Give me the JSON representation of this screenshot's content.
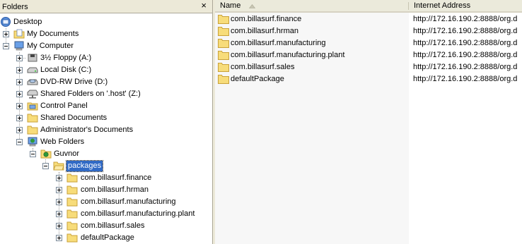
{
  "folders_pane": {
    "title": "Folders",
    "close_glyph": "×",
    "tree": [
      {
        "label": "Desktop",
        "icon": "desktop-icon"
      },
      {
        "label": "My Documents",
        "icon": "my-documents-icon"
      },
      {
        "label": "My Computer",
        "icon": "my-computer-icon"
      },
      {
        "label": "3½ Floppy (A:)",
        "icon": "floppy-drive-icon"
      },
      {
        "label": "Local Disk (C:)",
        "icon": "hard-disk-icon"
      },
      {
        "label": "DVD-RW Drive (D:)",
        "icon": "dvd-drive-icon"
      },
      {
        "label": "Shared Folders on '.host' (Z:)",
        "icon": "network-drive-icon"
      },
      {
        "label": "Control Panel",
        "icon": "control-panel-icon"
      },
      {
        "label": "Shared Documents",
        "icon": "folder-icon"
      },
      {
        "label": "Administrator's Documents",
        "icon": "folder-icon"
      },
      {
        "label": "Web Folders",
        "icon": "web-folders-icon"
      },
      {
        "label": "Guvnor",
        "icon": "web-folder-icon"
      },
      {
        "label": "packages",
        "icon": "open-folder-icon",
        "selected": true
      },
      {
        "label": "com.billasurf.finance",
        "icon": "folder-icon"
      },
      {
        "label": "com.billasurf.hrman",
        "icon": "folder-icon"
      },
      {
        "label": "com.billasurf.manufacturing",
        "icon": "folder-icon"
      },
      {
        "label": "com.billasurf.manufacturing.plant",
        "icon": "folder-icon"
      },
      {
        "label": "com.billasurf.sales",
        "icon": "folder-icon"
      },
      {
        "label": "defaultPackage",
        "icon": "folder-icon"
      }
    ]
  },
  "list_pane": {
    "columns": [
      {
        "label": "Name",
        "sorted": "ascending"
      },
      {
        "label": "Internet Address"
      }
    ],
    "rows": [
      {
        "name": "com.billasurf.finance",
        "address": "http://172.16.190.2:8888/org.d"
      },
      {
        "name": "com.billasurf.hrman",
        "address": "http://172.16.190.2:8888/org.d"
      },
      {
        "name": "com.billasurf.manufacturing",
        "address": "http://172.16.190.2:8888/org.d"
      },
      {
        "name": "com.billasurf.manufacturing.plant",
        "address": "http://172.16.190.2:8888/org.d"
      },
      {
        "name": "com.billasurf.sales",
        "address": "http://172.16.190.2:8888/org.d"
      },
      {
        "name": "defaultPackage",
        "address": "http://172.16.190.2:8888/org.d"
      }
    ]
  },
  "colors": {
    "selection": "#316ac5",
    "folder_fill": "#f7dc7a",
    "folder_stroke": "#c9a23a",
    "header_bg": "#ece9d8"
  }
}
